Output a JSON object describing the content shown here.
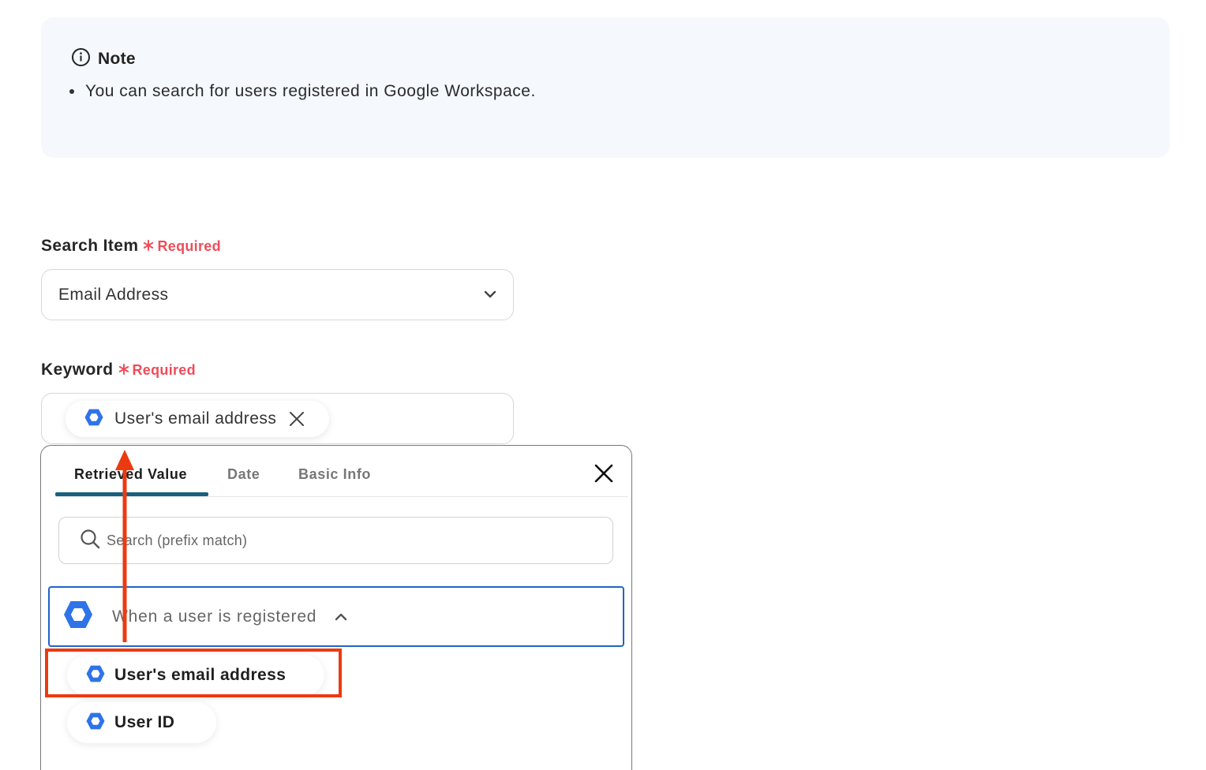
{
  "note": {
    "title": "Note",
    "icon": "info-icon",
    "bullets": [
      "You can search for users registered in Google Workspace."
    ]
  },
  "search_item": {
    "label": "Search Item",
    "required_label": "Required",
    "value": "Email Address"
  },
  "keyword": {
    "label": "Keyword",
    "required_label": "Required",
    "chip_label": "User's email address"
  },
  "picker": {
    "tabs": [
      {
        "label": "Retrieved Value",
        "active": true
      },
      {
        "label": "Date",
        "active": false
      },
      {
        "label": "Basic Info",
        "active": false
      }
    ],
    "search_placeholder": "Search (prefix match)",
    "group": {
      "label": "When a user is registered",
      "expanded": true,
      "icon": "google-workspace-hexagon-icon"
    },
    "options": [
      {
        "label": "User's email address",
        "highlighted": true
      },
      {
        "label": "User ID",
        "highlighted": false
      }
    ]
  },
  "colors": {
    "required": "#ef4d5a",
    "tab_underline": "#17607e",
    "group_border": "#1f64c6",
    "annotation": "#ec3a10",
    "hex_icon": "#2f73e8",
    "note_bg": "#f5f8fc"
  }
}
